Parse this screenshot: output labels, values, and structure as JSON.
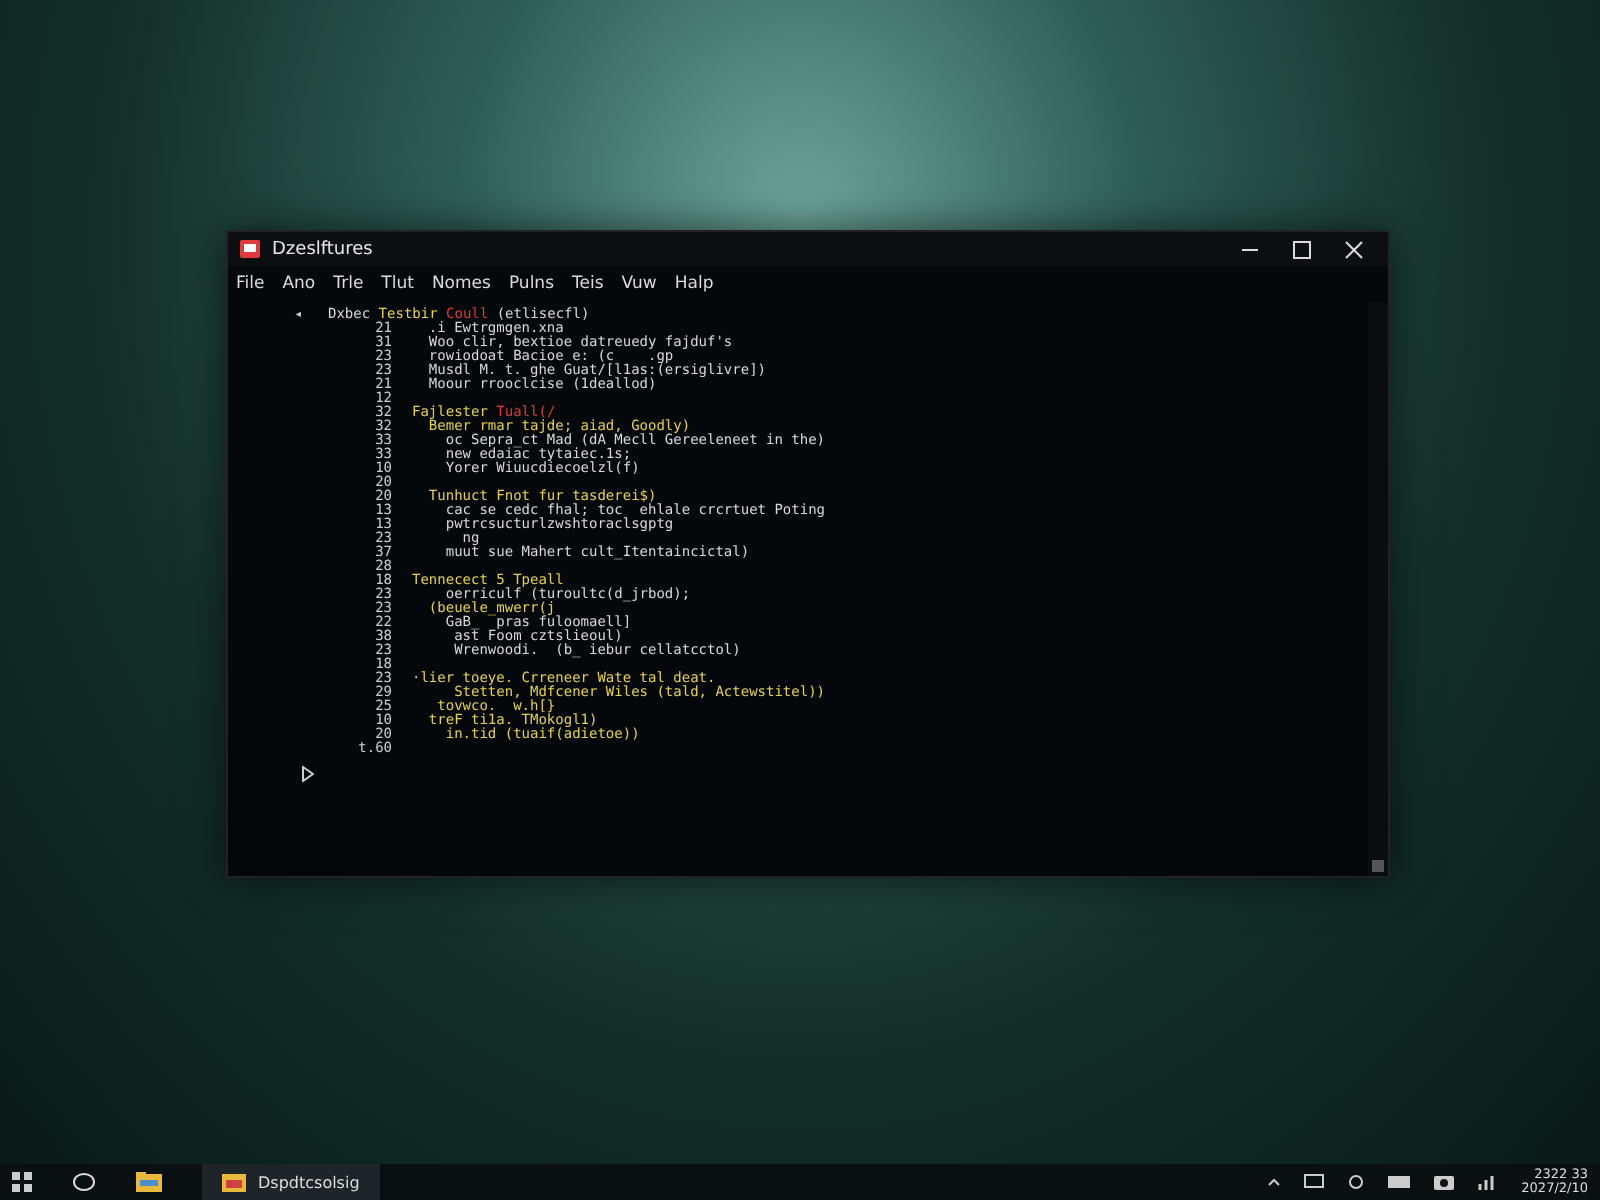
{
  "window": {
    "title": "Dzeslftures"
  },
  "menu": [
    "File",
    "Ano",
    "Trle",
    "Tlut",
    "Nomes",
    "Pulns",
    "Teis",
    "Vuw",
    "Halp"
  ],
  "code_lines": [
    {
      "marker": "◂",
      "segments": [
        {
          "text": "Dxbec ",
          "color": "#d8d8d8"
        },
        {
          "text": "Testbir ",
          "color": "#e6d24a"
        },
        {
          "text": "Coull ",
          "color": "#e03a32"
        },
        {
          "text": "(etlisecfl)",
          "color": "#d8d8d8"
        }
      ]
    },
    {
      "number": "21",
      "segments": [
        {
          "text": "  .i Ewtrgmgen.xna",
          "color": "#d8d8d8"
        }
      ]
    },
    {
      "number": "31",
      "segments": [
        {
          "text": "  Woo clir, bextioe datreuedy fajduf's",
          "color": "#d8d8d8"
        }
      ]
    },
    {
      "number": "23",
      "segments": [
        {
          "text": "  rowiodoat Bacioe e: (c    .gp",
          "color": "#d8d8d8"
        }
      ]
    },
    {
      "number": "23",
      "segments": [
        {
          "text": "  Musdl M. t. ghe Guat/[l1as:(ersiglivre])",
          "color": "#d8d8d8"
        }
      ]
    },
    {
      "number": "21",
      "segments": [
        {
          "text": "  Moour rrooclcise (1deallod)",
          "color": "#d8d8d8"
        }
      ]
    },
    {
      "number": "12"
    },
    {
      "number": "32",
      "segments": [
        {
          "text": "Fajlester ",
          "color": "#e6d24a"
        },
        {
          "text": "Tuall(/",
          "color": "#e03a32"
        }
      ]
    },
    {
      "number": "32",
      "segments": [
        {
          "text": "  Bemer rmar tajde; aiad, Goodly)",
          "color": "#e6d24a"
        }
      ]
    },
    {
      "number": "33",
      "segments": [
        {
          "text": "    oc Sepra_ct Mad (dA Mecll Gereeleneet in the)",
          "color": "#d8d8d8"
        }
      ]
    },
    {
      "number": "33",
      "segments": [
        {
          "text": "    new edaiac tytaiec.1s;",
          "color": "#d8d8d8"
        }
      ]
    },
    {
      "number": "10",
      "segments": [
        {
          "text": "    Yorer Wiuucdiecoelzl(f)",
          "color": "#d8d8d8"
        }
      ]
    },
    {
      "number": "20"
    },
    {
      "number": "20",
      "segments": [
        {
          "text": "  Tunhuct Fnot fur tasderei$)",
          "color": "#e6d24a"
        }
      ]
    },
    {
      "number": "13",
      "segments": [
        {
          "text": "    cac se cedc fhal; toc  ehlale crcrtuet Poting",
          "color": "#d8d8d8"
        }
      ]
    },
    {
      "number": "13",
      "segments": [
        {
          "text": "    pwtrcsucturlzwshtoraclsgptg",
          "color": "#d8d8d8"
        }
      ]
    },
    {
      "number": "23",
      "segments": [
        {
          "text": "      ng",
          "color": "#d8d8d8"
        }
      ]
    },
    {
      "number": "37",
      "segments": [
        {
          "text": "    muut sue Mahert cult_Itentaincictal)",
          "color": "#d8d8d8"
        }
      ]
    },
    {
      "number": "28"
    },
    {
      "number": "18",
      "segments": [
        {
          "text": "Tennecect 5 Tpeall",
          "color": "#e6d24a"
        }
      ]
    },
    {
      "number": "23",
      "segments": [
        {
          "text": "    oerriculf (turoultc(d_jrbod);",
          "color": "#d8d8d8"
        }
      ]
    },
    {
      "number": "23",
      "segments": [
        {
          "text": "  (beuele_mwerr(j",
          "color": "#e6d24a"
        }
      ]
    },
    {
      "number": "22",
      "segments": [
        {
          "text": "    GaB_  pras fuloomaell]",
          "color": "#d8d8d8"
        }
      ]
    },
    {
      "number": "38",
      "segments": [
        {
          "text": "     ast Foom cztslieoul)",
          "color": "#d8d8d8"
        }
      ]
    },
    {
      "number": "23",
      "segments": [
        {
          "text": "     Wrenwoodi.  (b_ iebur cellatcctol)",
          "color": "#d8d8d8"
        }
      ]
    },
    {
      "number": "18"
    },
    {
      "number": "23",
      "segments": [
        {
          "text": "·lier toeye. Crreneer Wate tal deat.",
          "color": "#e6d24a"
        }
      ]
    },
    {
      "number": "29",
      "segments": [
        {
          "text": "     Stetten, Mdfcener Wiles (tald, Actewstitel))",
          "color": "#e6d24a"
        }
      ]
    },
    {
      "number": "25",
      "segments": [
        {
          "text": "   tovwco.  w.h[}",
          "color": "#e6d24a"
        }
      ]
    },
    {
      "number": "10",
      "segments": [
        {
          "text": "  treF ti1a. TMokogl1)",
          "color": "#e6d24a"
        }
      ]
    },
    {
      "number": "20",
      "segments": [
        {
          "text": "    in.tid (tuaif(adietoe))",
          "color": "#e6d24a"
        }
      ]
    },
    {
      "number": "t.60"
    }
  ],
  "taskbar": {
    "app_label": "Dspdtcsolsig",
    "clock_time": "2322 33",
    "clock_date": "2027/2/10"
  }
}
